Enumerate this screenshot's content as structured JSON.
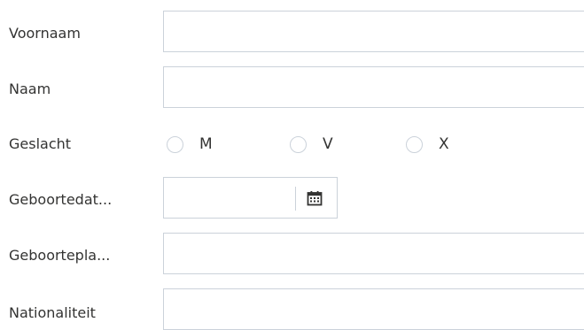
{
  "form": {
    "first_name": {
      "label": "Voornaam",
      "value": ""
    },
    "last_name": {
      "label": "Naam",
      "value": ""
    },
    "gender": {
      "label": "Geslacht",
      "options": [
        "M",
        "V",
        "X"
      ],
      "selected": ""
    },
    "birth_date": {
      "label": "Geboortedat...",
      "value": "",
      "icon": "calendar-icon"
    },
    "birth_place": {
      "label": "Geboortepla...",
      "value": ""
    },
    "nationality": {
      "label": "Nationaliteit",
      "value": ""
    }
  },
  "colors": {
    "border": "#cbd2da",
    "text": "#333332"
  }
}
